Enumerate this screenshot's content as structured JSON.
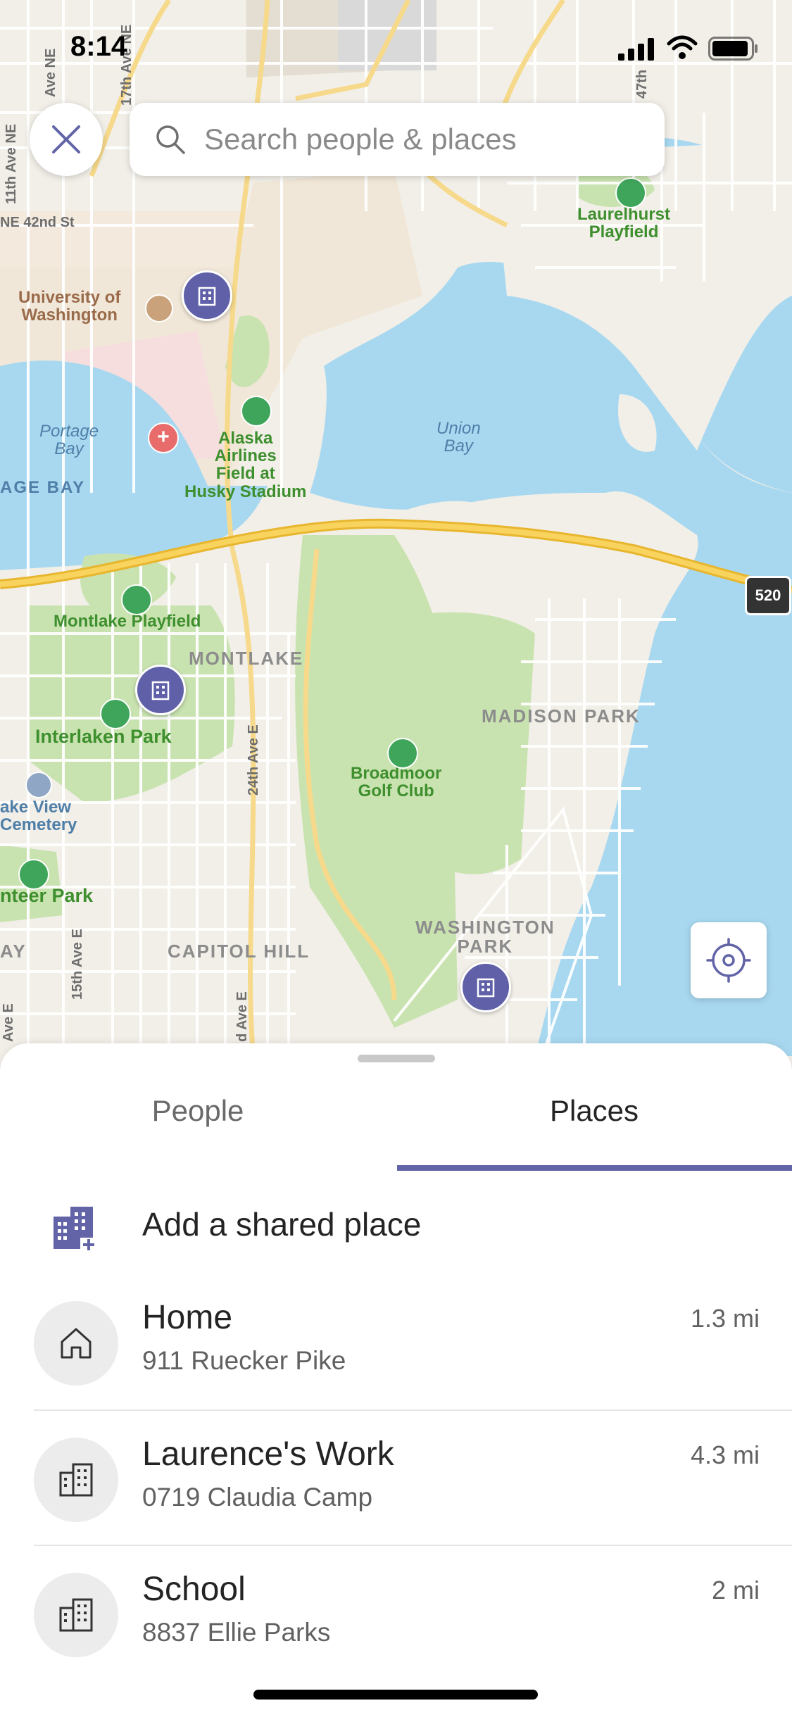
{
  "status_bar": {
    "time": "8:14"
  },
  "map": {
    "search_placeholder": "Search people & places",
    "labels": {
      "university": "University of\nWashington",
      "stadium": "Alaska\nAirlines\nField at\nHusky Stadium",
      "laurelhurst": "Laurelhurst\nPlayfield",
      "portage_bay": "Portage\nBay",
      "union_bay": "Union\nBay",
      "age_bay": "AGE BAY",
      "montlake_playfield": "Montlake Playfield",
      "montlake": "MONTLAKE",
      "interlaken": "Interlaken Park",
      "madison_park": "MADISON PARK",
      "broadmoor": "Broadmoor\nGolf Club",
      "lake_view": "ake View\nCemetery",
      "volunteer": "nteer Park",
      "capitol_hill": "CAPITOL HILL",
      "washington_park": "WASHINGTON\nPARK",
      "ne42": "NE 42nd St",
      "ave11": "11th Ave NE",
      "ave17": "17th Ave NE",
      "ave_ne": "Ave NE",
      "ave24": "24th Ave E",
      "ave15": "15th Ave E",
      "ave47": "47th",
      "ave_e": "Ave E",
      "ave_e2": "d Ave E",
      "route520": "520",
      "ay": "AY"
    }
  },
  "tabs": {
    "people": "People",
    "places": "Places"
  },
  "add_place_label": "Add a shared place",
  "places": [
    {
      "name": "Home",
      "address": "911 Ruecker Pike",
      "distance": "1.3 mi",
      "icon": "home-icon"
    },
    {
      "name": "Laurence's Work",
      "address": "0719 Claudia Camp",
      "distance": "4.3 mi",
      "icon": "building-icon"
    },
    {
      "name": "School",
      "address": "8837 Ellie Parks",
      "distance": "2 mi",
      "icon": "building-icon"
    }
  ],
  "colors": {
    "accent": "#6264a7",
    "pin": "#5f60a8",
    "water": "#a8d8f0",
    "park": "#c9e3b0",
    "land": "#f2efe8",
    "highway": "#f5c542"
  }
}
